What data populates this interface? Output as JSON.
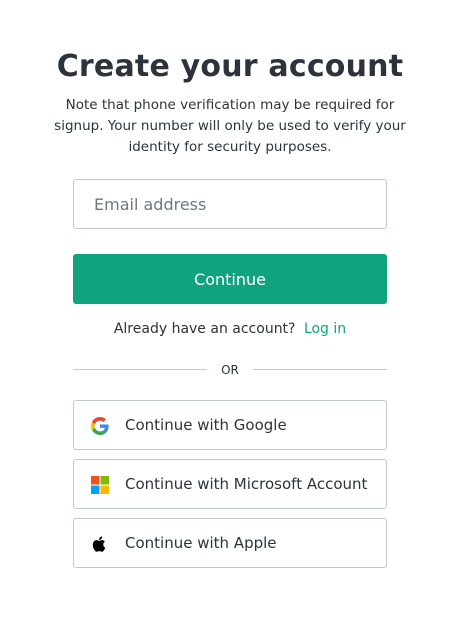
{
  "page": {
    "title": "Create your account",
    "subtitle": "Note that phone verification may be required for signup. Your number will only be used to verify your identity for security purposes."
  },
  "form": {
    "email_placeholder": "Email address",
    "email_value": "",
    "continue_label": "Continue"
  },
  "login": {
    "prompt": "Already have an account?",
    "link_label": "Log in"
  },
  "divider": {
    "label": "OR"
  },
  "social": [
    {
      "label": "Continue with Google",
      "icon": "google-icon"
    },
    {
      "label": "Continue with Microsoft Account",
      "icon": "microsoft-icon"
    },
    {
      "label": "Continue with Apple",
      "icon": "apple-icon"
    }
  ],
  "colors": {
    "accent": "#10a37f",
    "text": "#2d333a",
    "border": "#c2c8d0",
    "placeholder": "#6f7780"
  }
}
